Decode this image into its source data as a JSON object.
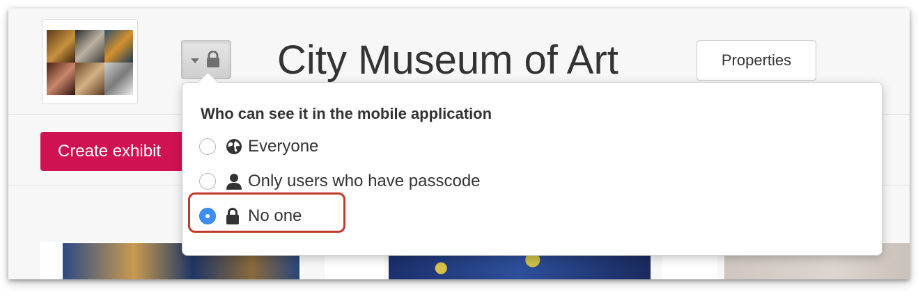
{
  "header": {
    "title": "City Museum of Art",
    "properties_label": "Properties"
  },
  "toolbar": {
    "create_exhibit_label": "Create exhibit"
  },
  "visibility_menu": {
    "heading": "Who can see it in the mobile application",
    "options": [
      {
        "label": "Everyone",
        "icon": "globe-icon",
        "selected": false
      },
      {
        "label": "Only users who have passcode",
        "icon": "user-icon",
        "selected": false
      },
      {
        "label": "No one",
        "icon": "lock-icon",
        "selected": true
      }
    ]
  },
  "colors": {
    "accent": "#d11252",
    "radio_selected": "#3d8ff3",
    "highlight_border": "#c0392b"
  }
}
